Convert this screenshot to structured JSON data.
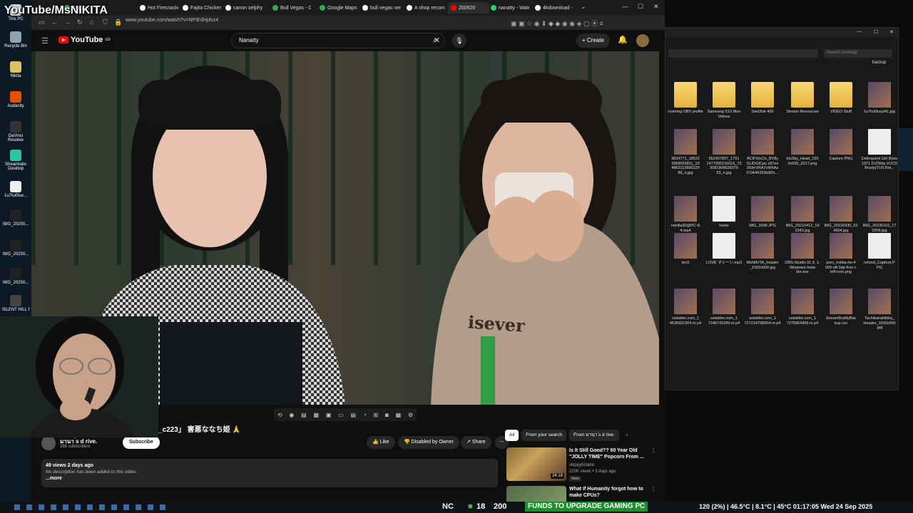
{
  "overlay": {
    "stream_title": "YouTube/MsNIKITA"
  },
  "desktop_icons": [
    {
      "label": "This PC",
      "color": "#cfd8dc"
    },
    {
      "label": "Recycle Bin",
      "color": "#90a4ae"
    },
    {
      "label": "Nikita",
      "color": "#e0c060"
    },
    {
      "label": "Audacity",
      "color": "#e65100"
    },
    {
      "label": "DaVinci Resolve",
      "color": "#333333"
    },
    {
      "label": "Streamlabs Desktop",
      "color": "#31c3a2"
    },
    {
      "label": "1u7lui0lux...",
      "color": "#eeeeee"
    },
    {
      "label": "IMG_20250...",
      "color": "#222222"
    },
    {
      "label": "IMG_20250...",
      "color": "#222222"
    },
    {
      "label": "IMG_20250...",
      "color": "#222222"
    },
    {
      "label": "SILENT HILL f",
      "color": "#444444"
    }
  ],
  "tabs": [
    {
      "label": "Support",
      "color": "#4caf50"
    },
    {
      "label": "Hot Firecracke",
      "color": "#ffffff"
    },
    {
      "label": "Fajita Chicken",
      "color": "#ffffff"
    },
    {
      "label": "canon selphy c",
      "color": "#ffffff"
    },
    {
      "label": "Bull Vegas - Gi",
      "color": "#34a853"
    },
    {
      "label": "Google Maps",
      "color": "#34a853"
    },
    {
      "label": "bull vegas sen",
      "color": "#ffffff"
    },
    {
      "label": "A shop recomm",
      "color": "#ffffff"
    },
    {
      "label": "250920",
      "color": "#ff0000"
    },
    {
      "label": "nanatty - Wate",
      "color": "#2ecc71"
    },
    {
      "label": "4kdownload -",
      "color": "#ffffff"
    }
  ],
  "address": {
    "url": "www.youtube.com/watch?v=NPIEdHjdvz4"
  },
  "youtube": {
    "logo": "YouTube",
    "logo_country": "GB",
    "search_value": "Nanatty",
    "create_label": "Create"
  },
  "video": {
    "title": "_c223」 害悪ななち姫 🙏",
    "shirt_text": "isever",
    "channel_name": "มานา ́s d rive.",
    "subscribers": "288 subscribers",
    "subscribe_label": "Subscribe",
    "like_label": "Like",
    "disabled_label": "Disabled by Owner",
    "share_label": "Share",
    "views_date": "49 views  2 days ago",
    "description": "No description has been added to this video.",
    "more_label": "...more"
  },
  "sidebar": {
    "chips": [
      "All",
      "From your search",
      "From มานา ́s d rive."
    ],
    "recs": [
      {
        "title": "Is It Still Good?? 90 Year Old \"JOLLY TIME\" Popcorn From ...",
        "channel": "skippy62able",
        "meta": "220K views • 3 days ago",
        "duration": "24:19",
        "badge": "New"
      },
      {
        "title": "What If Humanity forgot how to make CPUs?",
        "channel": "",
        "meta": "",
        "duration": "",
        "badge": ""
      }
    ]
  },
  "explorer": {
    "search_placeholder": "Search Desktop",
    "backup_label": "backup",
    "files": [
      {
        "label": "rcoming OBS profile",
        "type": "folder"
      },
      {
        "label": "Samsung S10 Mon Videos",
        "type": "folder"
      },
      {
        "label": "SanDisk 400",
        "type": "folder"
      },
      {
        "label": "Stream Resources",
        "type": "folder"
      },
      {
        "label": "VIDEO Stuff",
        "type": "folder"
      },
      {
        "label": "1u7lui0luxyi41.jpg",
        "type": "img"
      },
      {
        "label": "3834771_18522 2689063811_19 4862113566229 89_n.jpg",
        "type": "img"
      },
      {
        "label": "552407897_1791 1477005216016_73 3081906626070 53_n.jpg",
        "type": "img"
      },
      {
        "label": "ACIP3zcCk_BV8y GUOGICpu z87ex Z6dnVRA7xWhAz FOA46XD9s82x...",
        "type": "img"
      },
      {
        "label": "bluSky_Head_150 0x500_2017.png",
        "type": "img"
      },
      {
        "label": "Capture.PNG",
        "type": "img"
      },
      {
        "label": "Delinquent Girl Boss 1971 DVDRip XVCD Brady(TUS Rel...",
        "type": "file"
      },
      {
        "label": "ndzilla30@PC-S 4.mp4",
        "type": "img"
      },
      {
        "label": "hosts",
        "type": "file"
      },
      {
        "label": "IMG_2098.JPG",
        "type": "img"
      },
      {
        "label": "IMG_20210412_19 2343.jpg",
        "type": "img"
      },
      {
        "label": "IMG_20220930_02 4604.jpg",
        "type": "img"
      },
      {
        "label": "IMG_20230115_17 0206.jpg",
        "type": "img"
      },
      {
        "label": "leo3",
        "type": "img"
      },
      {
        "label": "LOVE マシーン.mp3",
        "type": "file"
      },
      {
        "label": "MsNIKITA_header _1500x500.jpg",
        "type": "img"
      },
      {
        "label": "OBS-Studio-31.0. 1-Windows-Insta ller.exe",
        "type": "img"
      },
      {
        "label": "prev_nvidia-rtx-4 000-off-3qtr-fron t-left-icon.png",
        "type": "img"
      },
      {
        "label": "refund_Capture.P PG",
        "type": "file"
      },
      {
        "label": "sstwitter.com_1 4536931904.m p4",
        "type": "img"
      },
      {
        "label": "sstwitter.com_1 7246743289.m p4",
        "type": "img"
      },
      {
        "label": "sstwitter.com_1 7272147689S4.m p4",
        "type": "img"
      },
      {
        "label": "sstwitter.com_1 7276864969.m p4",
        "type": "img"
      },
      {
        "label": "StreamBuddyBac kup.csv",
        "type": "img"
      },
      {
        "label": "TachibanaNikita_ Header_1500x500 .jpg",
        "type": "img"
      }
    ]
  },
  "taskbar": {
    "nc": "NC",
    "num1": "18",
    "num2": "200",
    "funds": "FUNDS TO UPGRADE GAMING PC",
    "right_text": "120 (2%)  |  46.5°C  |  8.1°C | 45°C  01:17:05  Wed 24 Sep 2025"
  }
}
